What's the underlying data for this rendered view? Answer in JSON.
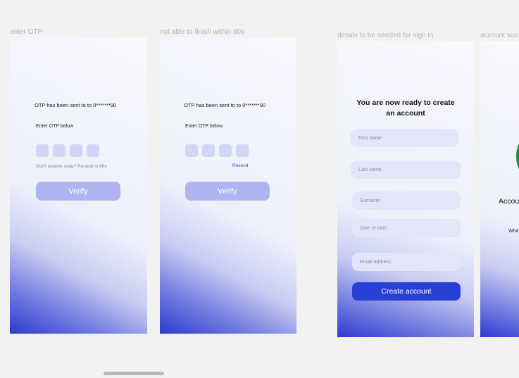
{
  "frames": {
    "enter_otp": {
      "label": "enter OTP",
      "sent_text": "OTP has been sent to to 0*******90",
      "enter_text": "Enter OTP below",
      "resend_text": "Don't receive code? Resend in 60s",
      "verify_label": "Verify"
    },
    "timeout": {
      "label": "not able to finish within 60s",
      "sent_text": "OTP has been sent to to 0*******90",
      "enter_text": "Enter OTP below",
      "resend_link": "Resend",
      "verify_label": "Verify"
    },
    "signup": {
      "label": "details to be needed for sign in",
      "heading_line1": "You are now ready to create",
      "heading_line2": "an account",
      "first_name_placeholder": "First name",
      "last_name_placeholder": "Last name",
      "surname_placeholder": "Surname",
      "dob_placeholder": "Date of birth",
      "email_placeholder": "Email address",
      "create_label": "Create account"
    },
    "success": {
      "label": "account suc",
      "title_partial": "Accou",
      "body_partial": "Wha",
      "accent_color": "#1e8a3c"
    }
  },
  "colors": {
    "primary": "#2840d6",
    "button_disabled": "#aeb5f0",
    "otp_box": "#d1d5f6",
    "field_bg": "#e3e6f8",
    "canvas_bg": "#f3f2f3"
  }
}
